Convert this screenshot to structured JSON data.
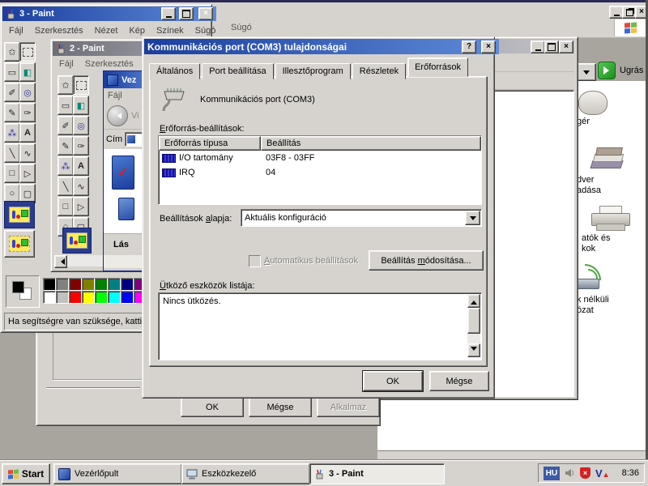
{
  "background_window": {
    "menu_help": "Súgó",
    "address_go": "Ugrás",
    "fragments": {
      "mouse": "gér",
      "hardware1": "dver",
      "hardware2": "adása",
      "printers1": "atók és",
      "printers2": "kok",
      "wireless1": "k nélküli",
      "wireless2": "ózat"
    }
  },
  "paint3": {
    "title": "3 - Paint",
    "menu": [
      "Fájl",
      "Szerkesztés",
      "Nézet",
      "Kép",
      "Színek",
      "Súgó"
    ],
    "status": "Ha segítségre van szüksége, kattin"
  },
  "paint2": {
    "title": "2 - Paint",
    "menu": [
      "Fájl",
      "Szerkesztés"
    ]
  },
  "mini_window": {
    "title": "Vez",
    "menu_file": "Fájl",
    "back": "Vi",
    "address_label": "Cím",
    "see_also": "Lás"
  },
  "tools": [
    "✩",
    "",
    "▭",
    "◧",
    "✐",
    "◎",
    "✎",
    "✑",
    "⁂",
    "A",
    "╲",
    "∿",
    "□",
    "▷",
    "○",
    "▢"
  ],
  "palette": {
    "row1": [
      "#000000",
      "#808080",
      "#800000",
      "#808000",
      "#008000",
      "#008080",
      "#000080",
      "#800080",
      "#808040"
    ],
    "row2": [
      "#FFFFFF",
      "#C0C0C0",
      "#FF0000",
      "#FFFF00",
      "#00FF00",
      "#00FFFF",
      "#0000FF",
      "#FF00FF",
      "#FFFF80"
    ]
  },
  "dialog": {
    "title": "Kommunikációs port (COM3) tulajdonságai",
    "help": "?",
    "tabs": [
      "Általános",
      "Port beállítása",
      "Illesztőprogram",
      "Részletek",
      "Erőforrások"
    ],
    "active_tab": "Erőforrások",
    "device_name": "Kommunikációs port (COM3)",
    "resource_label": {
      "pre": "",
      "u": "E",
      "post": "rőforrás-beállítások:"
    },
    "list_headers": [
      "Erőforrás típusa",
      "Beállítás"
    ],
    "rows": [
      {
        "type": "I/O tartomány",
        "value": "03F8 - 03FF"
      },
      {
        "type": "IRQ",
        "value": "04"
      }
    ],
    "basis_label": {
      "pre": "Beállítások ",
      "u": "a",
      "post": "lapja:"
    },
    "basis_value": "Aktuális konfiguráció",
    "auto_label": {
      "pre": "",
      "u": "A",
      "post": "utomatikus beállítások"
    },
    "modify_button": {
      "pre": "Beállítás ",
      "u": "m",
      "post": "ódosítása..."
    },
    "conflict_label": {
      "pre": "",
      "u": "Ü",
      "post": "tköző eszközök listája:"
    },
    "conflict_text": "Nincs ütközés.",
    "ok": "OK",
    "cancel": "Mégse"
  },
  "parent_dialog": {
    "ok": "OK",
    "cancel": "Mégse",
    "apply": "Alkalmaz"
  },
  "taskbar": {
    "start": "Start",
    "tasks": [
      "Vezérlőpult",
      "Eszközkezelő",
      "3 - Paint"
    ],
    "tray": {
      "lang": "HU",
      "time": "8:36"
    }
  },
  "colors": {
    "titlebar_from": "#1B3E9E",
    "titlebar_to": "#5E8AD8",
    "inactive_title": "#6E6E78",
    "face": "#D6D3CE",
    "desktop": "#A8A59E",
    "go_green": "#21A121",
    "chip_blue": "#2A2AC8",
    "lang_badge": "#3C5AA8"
  }
}
